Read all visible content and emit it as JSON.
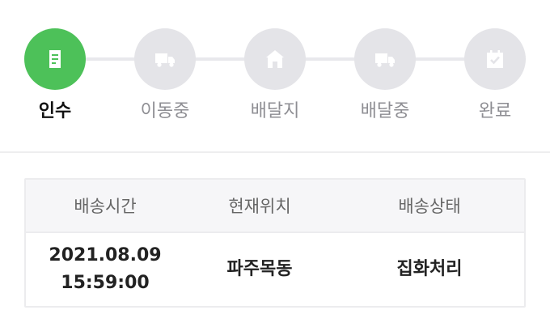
{
  "progress": {
    "current_step": 1,
    "steps": [
      {
        "label": "인수",
        "icon": "document-icon",
        "active": true
      },
      {
        "label": "이동중",
        "icon": "truck-icon",
        "active": false
      },
      {
        "label": "배달지",
        "icon": "house-icon",
        "active": false
      },
      {
        "label": "배달중",
        "icon": "truck-icon",
        "active": false
      },
      {
        "label": "완료",
        "icon": "calendar-check-icon",
        "active": false
      }
    ],
    "colors": {
      "active": "#4dc159",
      "inactive": "#e4e4e8",
      "inactive_icon": "#ffffff"
    }
  },
  "tracking_table": {
    "headers": [
      "배송시간",
      "현재위치",
      "배송상태"
    ],
    "row": {
      "date": "2021.08.09",
      "time": "15:59:00",
      "location": "파주목동",
      "status": "집화처리"
    }
  }
}
